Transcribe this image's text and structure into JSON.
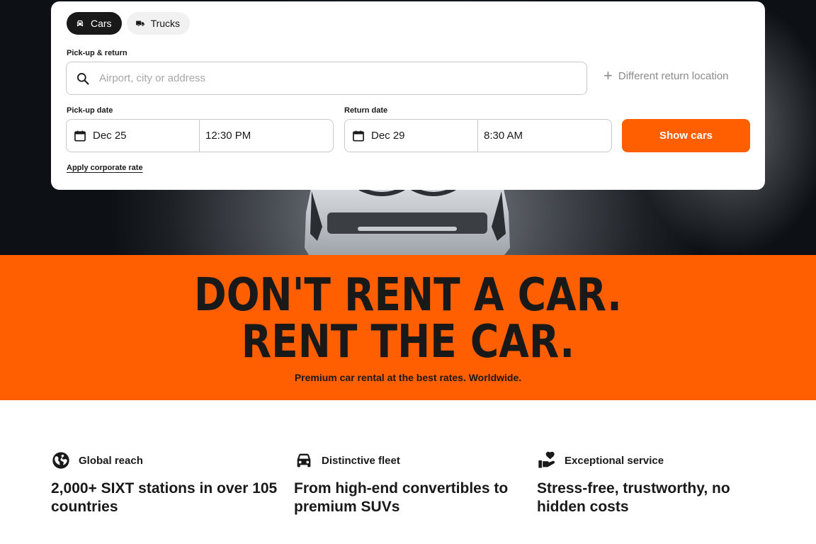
{
  "search": {
    "tabs": [
      {
        "label": "Cars",
        "icon": "car-icon",
        "active": true
      },
      {
        "label": "Trucks",
        "icon": "truck-icon",
        "active": false
      }
    ],
    "pickup_return_label": "Pick-up & return",
    "location_placeholder": "Airport, city or address",
    "different_return_label": "Different return location",
    "pickup_date_label": "Pick-up date",
    "pickup_date": "Dec 25",
    "pickup_time": "12:30 PM",
    "return_date_label": "Return date",
    "return_date": "Dec 29",
    "return_time": "8:30 AM",
    "show_button": "Show cars",
    "corporate_link": "Apply corporate rate"
  },
  "hero": {
    "headline_line1": "DON'T RENT A CAR.",
    "headline_line2": "RENT THE CAR.",
    "subline": "Premium car rental at the best rates. Worldwide."
  },
  "features": [
    {
      "icon": "globe-icon",
      "title": "Global reach",
      "text": "2,000+ SIXT stations in over 105 countries"
    },
    {
      "icon": "car-front-icon",
      "title": "Distinctive fleet",
      "text": "From high-end convertibles to premium SUVs"
    },
    {
      "icon": "heart-hand-icon",
      "title": "Exceptional service",
      "text": "Stress-free, trustworthy, no hidden costs"
    }
  ],
  "colors": {
    "accent": "#ff5f00",
    "dark": "#191919"
  }
}
